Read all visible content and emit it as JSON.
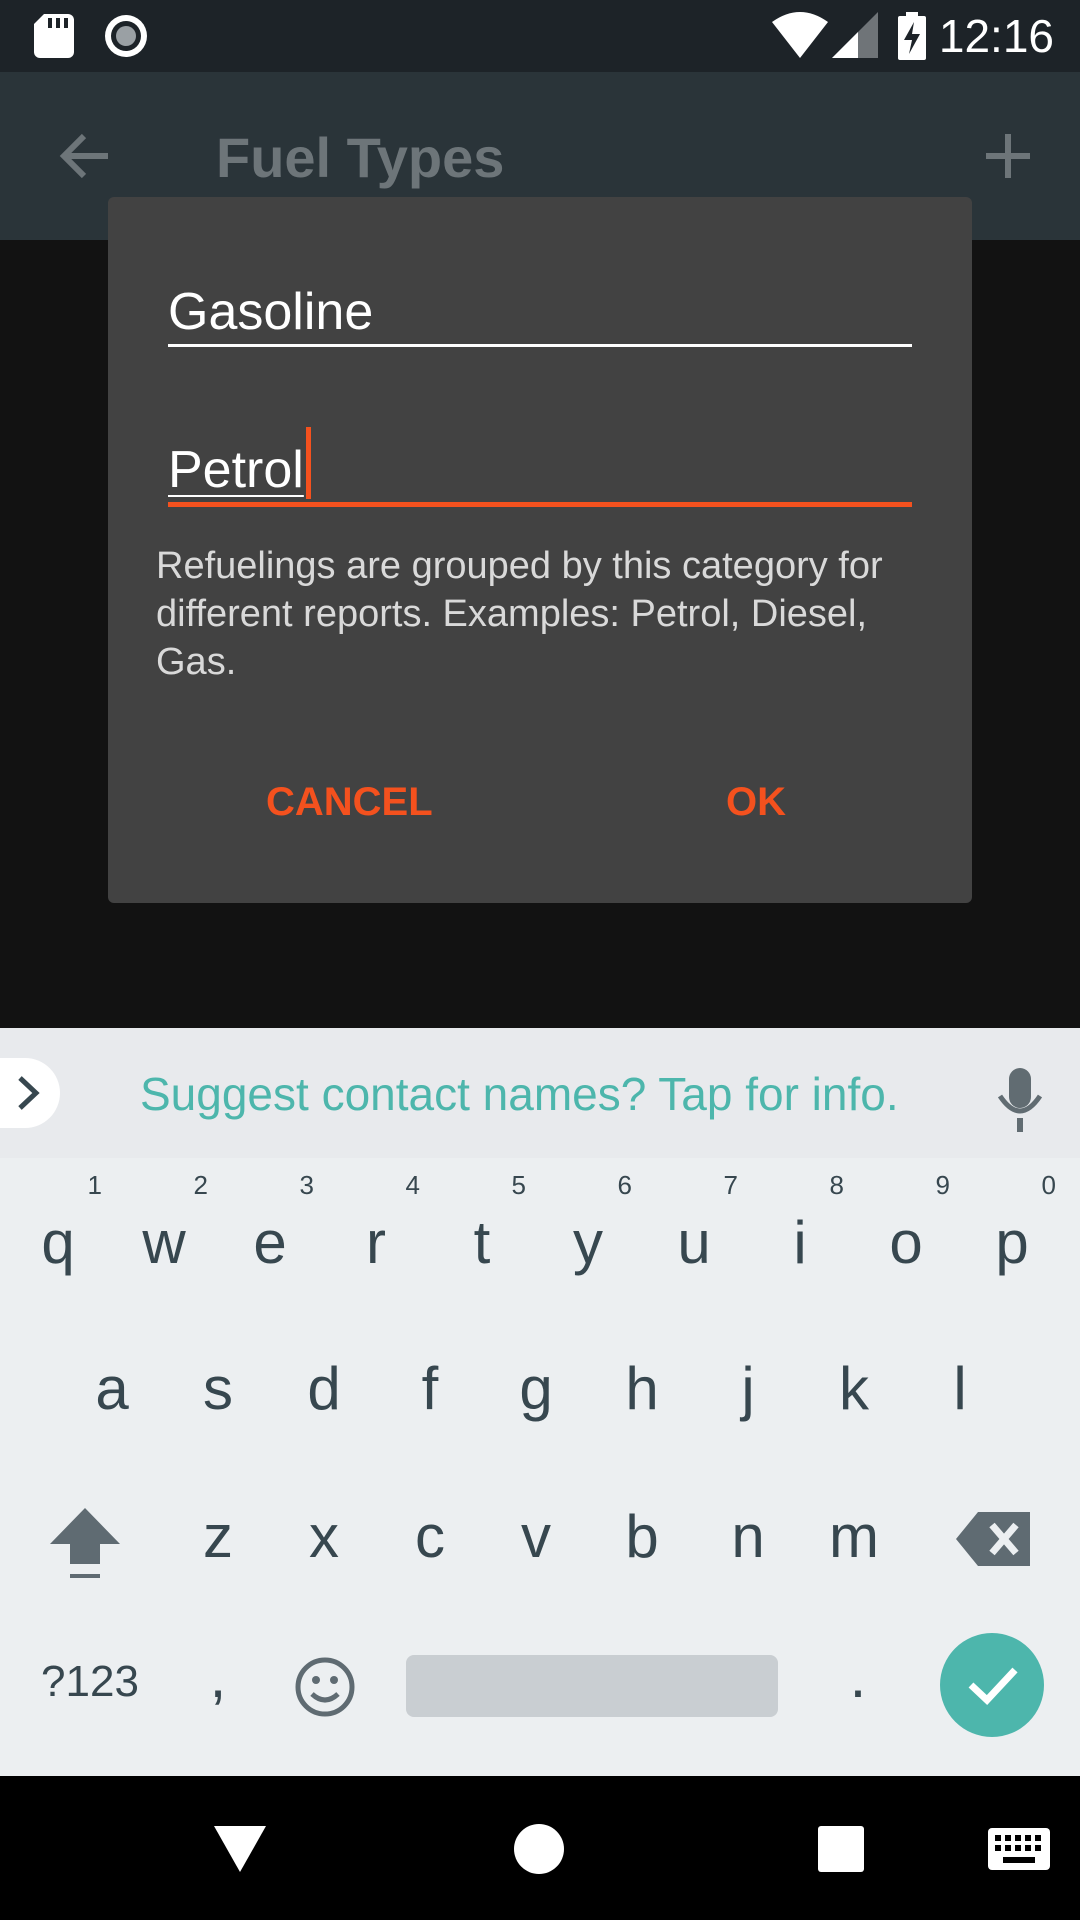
{
  "status_bar": {
    "time": "12:16",
    "icons": [
      "sd-card-icon",
      "record-icon",
      "wifi-icon",
      "signal-icon",
      "battery-charging-icon"
    ]
  },
  "toolbar": {
    "title": "Fuel Types",
    "back_icon": "arrow-back-icon",
    "add_icon": "plus-icon"
  },
  "dialog": {
    "name_value": "Gasoline",
    "category_value": "Petrol",
    "helper_text": "Refuelings are grouped by this category for different reports. Examples: Petrol, Diesel, Gas.",
    "cancel_label": "CANCEL",
    "ok_label": "OK",
    "accent_color": "#f4511e"
  },
  "keyboard": {
    "suggestion": "Suggest contact names? Tap for info.",
    "row1": [
      {
        "key": "q",
        "hint": "1"
      },
      {
        "key": "w",
        "hint": "2"
      },
      {
        "key": "e",
        "hint": "3"
      },
      {
        "key": "r",
        "hint": "4"
      },
      {
        "key": "t",
        "hint": "5"
      },
      {
        "key": "y",
        "hint": "6"
      },
      {
        "key": "u",
        "hint": "7"
      },
      {
        "key": "i",
        "hint": "8"
      },
      {
        "key": "o",
        "hint": "9"
      },
      {
        "key": "p",
        "hint": "0"
      }
    ],
    "row2": [
      "a",
      "s",
      "d",
      "f",
      "g",
      "h",
      "j",
      "k",
      "l"
    ],
    "row3": [
      "z",
      "x",
      "c",
      "v",
      "b",
      "n",
      "m"
    ],
    "symbols_label": "?123",
    "comma": ",",
    "period": ".",
    "accent_color": "#4db6ac"
  },
  "nav_bar": {
    "icons": [
      "back-triangle-icon",
      "home-circle-icon",
      "recents-square-icon",
      "keyboard-icon"
    ]
  }
}
